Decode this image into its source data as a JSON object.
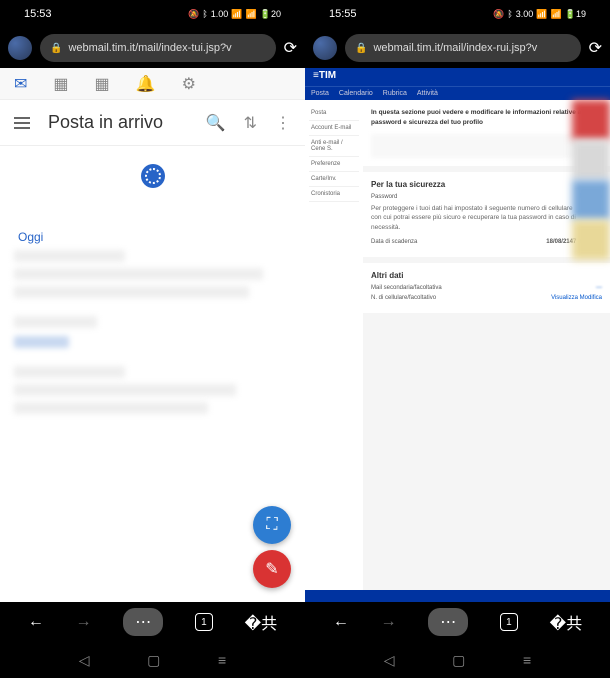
{
  "left": {
    "status": {
      "time": "15:53",
      "net": "1.00",
      "battery": "20"
    },
    "url": "webmail.tim.it/mail/index-tui.jsp?v",
    "title": "Posta in arrivo",
    "date_label": "Oggi",
    "tab_count": "1"
  },
  "right": {
    "status": {
      "time": "15:55",
      "net": "3.00",
      "battery": "19"
    },
    "url": "webmail.tim.it/mail/index-rui.jsp?v",
    "brand": "TIM",
    "nav": [
      "Posta",
      "Calendario",
      "Rubrica",
      "Attività"
    ],
    "sidebar": [
      "Posta",
      "Account E-mail",
      "Anti e-mail / Cene S.",
      "Preferenze",
      "Carte/Inv.",
      "Cronistoria"
    ],
    "intro": "In questa sezione puoi vedere e modificare le informazioni relative a password e sicurezza del tuo profilo",
    "security": {
      "title": "Per la tua sicurezza",
      "pw_label": "Password",
      "pw_action": "Modifica",
      "text1": "Per proteggere i tuoi dati hai impostato il seguente numero di cellulare",
      "text2": "con cui potrai essere più sicuro e recuperare la tua password in caso di necessità.",
      "date_label": "Data di scadenza",
      "date_val": "18/08/2147",
      "date_action": "modifica"
    },
    "other": {
      "title": "Altri dati",
      "f1": "Mail secondaria/facoltativa",
      "f2": "N. di cellulare/facoltativo",
      "view": "Visualizza",
      "edit": "Modifica"
    },
    "tab_count": "1"
  }
}
